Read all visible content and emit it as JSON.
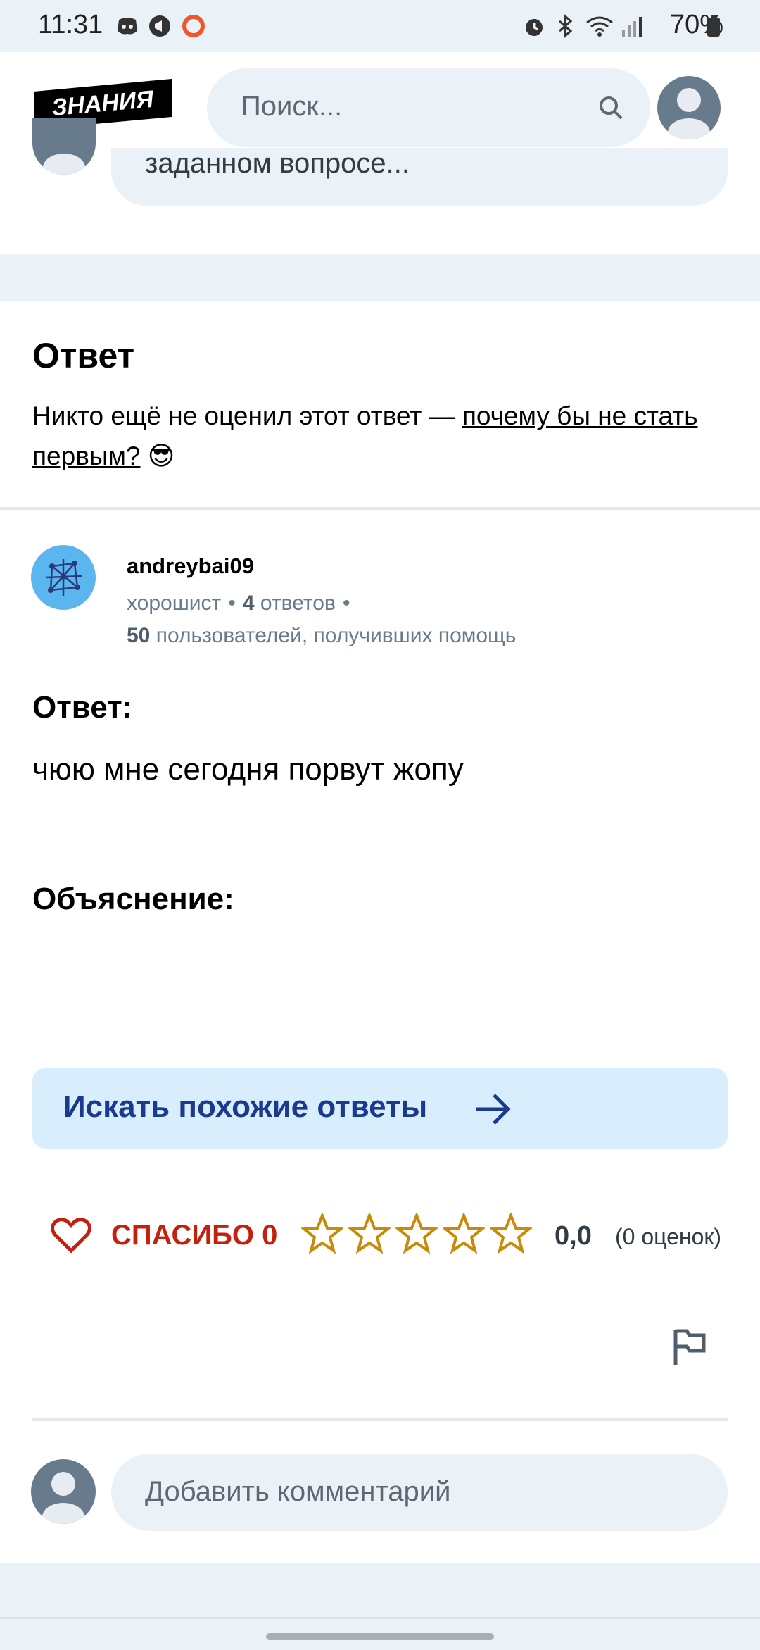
{
  "status_bar": {
    "time": "11:31",
    "battery": "70%",
    "icons": [
      "discord-icon",
      "megaphone-icon",
      "record-icon",
      "alarm-icon",
      "bluetooth-icon",
      "wifi-icon",
      "signal-icon",
      "battery-icon"
    ]
  },
  "header": {
    "logo_text": "ЗНАНИЯ",
    "search_placeholder": "Поиск..."
  },
  "previous_comment": {
    "text": "заданном вопросе..."
  },
  "answer_section": {
    "title": "Ответ",
    "note_prefix": "Никто ещё не оценил этот ответ — ",
    "note_link": "почему бы не стать первым?",
    "note_emoji": "😎"
  },
  "answerer": {
    "username": "andreybai09",
    "rank": "хорошист",
    "answers_count": "4",
    "answers_label": "ответов",
    "helped_count": "50",
    "helped_label": "пользователей, получивших помощь"
  },
  "answer": {
    "label": "Ответ:",
    "text": "чюю мне сегодня порвут жопу",
    "explanation_label": "Объяснение:"
  },
  "similar_button": {
    "label": "Искать похожие ответы"
  },
  "rating": {
    "thanks_label": "СПАСИБО 0",
    "stars_filled": 0,
    "stars_total": 5,
    "score": "0,0",
    "count_label": "(0 оценок)",
    "star_color": "#c98a0a"
  },
  "comment": {
    "placeholder": "Добавить комментарий"
  }
}
